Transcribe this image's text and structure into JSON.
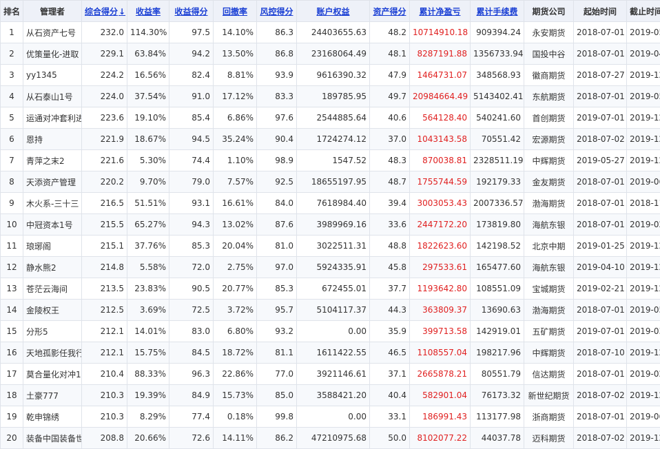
{
  "table": {
    "headers": {
      "rank": "排名",
      "manager": "管理者",
      "composite_score": "综合得分",
      "sort_arrow": "↓",
      "return_rate": "收益率",
      "return_score": "收益得分",
      "drawdown": "回撤率",
      "risk_score": "风控得分",
      "equity": "账户权益",
      "asset_score": "资产得分",
      "net_pnl": "累计净盈亏",
      "fees": "累计手续费",
      "broker": "期货公司",
      "start_date": "起始时间",
      "end_date": "截止时间"
    },
    "pnl_color": "#e02020",
    "link_color": "#1a3fd4",
    "rows": [
      {
        "rank": "1",
        "manager": "从石资产七号",
        "composite_score": "232.0",
        "return_rate": "114.30%",
        "return_score": "97.5",
        "drawdown": "14.10%",
        "risk_score": "86.3",
        "equity": "24403655.63",
        "asset_score": "48.2",
        "net_pnl": "10714910.18",
        "fees": "909394.24",
        "broker": "永安期货",
        "start_date": "2018-07-01",
        "end_date": "2019-05-08"
      },
      {
        "rank": "2",
        "manager": "优策量化-进取",
        "composite_score": "229.1",
        "return_rate": "63.84%",
        "return_score": "94.2",
        "drawdown": "13.50%",
        "risk_score": "86.8",
        "equity": "23168064.49",
        "asset_score": "48.1",
        "net_pnl": "8287191.88",
        "fees": "1356733.94",
        "broker": "国投中谷",
        "start_date": "2018-07-01",
        "end_date": "2019-04-15"
      },
      {
        "rank": "3",
        "manager": "yy1345",
        "composite_score": "224.2",
        "return_rate": "16.56%",
        "return_score": "82.4",
        "drawdown": "8.81%",
        "risk_score": "93.9",
        "equity": "9616390.32",
        "asset_score": "47.9",
        "net_pnl": "1464731.07",
        "fees": "348568.93",
        "broker": "徽商期货",
        "start_date": "2018-07-27",
        "end_date": "2019-12-30"
      },
      {
        "rank": "4",
        "manager": "从石泰山1号",
        "composite_score": "224.0",
        "return_rate": "37.54%",
        "return_score": "91.0",
        "drawdown": "17.12%",
        "risk_score": "83.3",
        "equity": "189785.95",
        "asset_score": "49.7",
        "net_pnl": "20984664.49",
        "fees": "5143402.41",
        "broker": "东航期货",
        "start_date": "2018-07-01",
        "end_date": "2019-05-08"
      },
      {
        "rank": "5",
        "manager": "运通对冲套利进",
        "composite_score": "223.6",
        "return_rate": "19.10%",
        "return_score": "85.4",
        "drawdown": "6.86%",
        "risk_score": "97.6",
        "equity": "2544885.64",
        "asset_score": "40.6",
        "net_pnl": "564128.40",
        "fees": "540241.60",
        "broker": "首创期货",
        "start_date": "2019-07-01",
        "end_date": "2019-12-30"
      },
      {
        "rank": "6",
        "manager": "恩持",
        "composite_score": "221.9",
        "return_rate": "18.67%",
        "return_score": "94.5",
        "drawdown": "35.24%",
        "risk_score": "90.4",
        "equity": "1724274.12",
        "asset_score": "37.0",
        "net_pnl": "1043143.58",
        "fees": "70551.42",
        "broker": "宏源期货",
        "start_date": "2018-07-02",
        "end_date": "2019-12-30"
      },
      {
        "rank": "7",
        "manager": "青萍之末2",
        "composite_score": "221.6",
        "return_rate": "5.30%",
        "return_score": "74.4",
        "drawdown": "1.10%",
        "risk_score": "98.9",
        "equity": "1547.52",
        "asset_score": "48.3",
        "net_pnl": "870038.81",
        "fees": "2328511.19",
        "broker": "中辉期货",
        "start_date": "2019-05-27",
        "end_date": "2019-12-30"
      },
      {
        "rank": "8",
        "manager": "天添资产管理",
        "composite_score": "220.2",
        "return_rate": "9.70%",
        "return_score": "79.0",
        "drawdown": "7.57%",
        "risk_score": "92.5",
        "equity": "18655197.95",
        "asset_score": "48.7",
        "net_pnl": "1755744.59",
        "fees": "192179.33",
        "broker": "金友期货",
        "start_date": "2018-07-01",
        "end_date": "2019-06-27"
      },
      {
        "rank": "9",
        "manager": "木火系-三十三",
        "composite_score": "216.5",
        "return_rate": "51.51%",
        "return_score": "93.1",
        "drawdown": "16.61%",
        "risk_score": "84.0",
        "equity": "7618984.40",
        "asset_score": "39.4",
        "net_pnl": "3003053.43",
        "fees": "2007336.57",
        "broker": "渤海期货",
        "start_date": "2018-07-01",
        "end_date": "2018-11-26"
      },
      {
        "rank": "10",
        "manager": "中冠资本1号",
        "composite_score": "215.5",
        "return_rate": "65.27%",
        "return_score": "94.3",
        "drawdown": "13.02%",
        "risk_score": "87.6",
        "equity": "3989969.16",
        "asset_score": "33.6",
        "net_pnl": "2447172.20",
        "fees": "173819.80",
        "broker": "海航东银",
        "start_date": "2018-07-01",
        "end_date": "2019-02-22"
      },
      {
        "rank": "11",
        "manager": "琅琊阁",
        "composite_score": "215.1",
        "return_rate": "37.76%",
        "return_score": "85.3",
        "drawdown": "20.04%",
        "risk_score": "81.0",
        "equity": "3022511.31",
        "asset_score": "48.8",
        "net_pnl": "1822623.60",
        "fees": "142198.52",
        "broker": "北京中期",
        "start_date": "2019-01-25",
        "end_date": "2019-12-30"
      },
      {
        "rank": "12",
        "manager": "静水熊2",
        "composite_score": "214.8",
        "return_rate": "5.58%",
        "return_score": "72.0",
        "drawdown": "2.75%",
        "risk_score": "97.0",
        "equity": "5924335.91",
        "asset_score": "45.8",
        "net_pnl": "297533.61",
        "fees": "165477.60",
        "broker": "海航东银",
        "start_date": "2019-04-10",
        "end_date": "2019-12-30"
      },
      {
        "rank": "13",
        "manager": "苍茫云海间",
        "composite_score": "213.5",
        "return_rate": "23.83%",
        "return_score": "90.5",
        "drawdown": "20.77%",
        "risk_score": "85.3",
        "equity": "672455.01",
        "asset_score": "37.7",
        "net_pnl": "1193642.80",
        "fees": "108551.09",
        "broker": "宝城期货",
        "start_date": "2019-02-21",
        "end_date": "2019-12-30"
      },
      {
        "rank": "14",
        "manager": "金陵权王",
        "composite_score": "212.5",
        "return_rate": "3.69%",
        "return_score": "72.5",
        "drawdown": "3.72%",
        "risk_score": "95.7",
        "equity": "5104117.37",
        "asset_score": "44.3",
        "net_pnl": "363809.37",
        "fees": "13690.63",
        "broker": "渤海期货",
        "start_date": "2018-07-01",
        "end_date": "2019-05-13"
      },
      {
        "rank": "15",
        "manager": "分形5",
        "composite_score": "212.1",
        "return_rate": "14.01%",
        "return_score": "83.0",
        "drawdown": "6.80%",
        "risk_score": "93.2",
        "equity": "0.00",
        "asset_score": "35.9",
        "net_pnl": "399713.58",
        "fees": "142919.01",
        "broker": "五矿期货",
        "start_date": "2019-07-01",
        "end_date": "2019-03-19"
      },
      {
        "rank": "16",
        "manager": "天地孤影任我行",
        "composite_score": "212.1",
        "return_rate": "15.75%",
        "return_score": "84.5",
        "drawdown": "18.72%",
        "risk_score": "81.1",
        "equity": "1611422.55",
        "asset_score": "46.5",
        "net_pnl": "1108557.04",
        "fees": "198217.96",
        "broker": "中辉期货",
        "start_date": "2018-07-10",
        "end_date": "2019-12-30"
      },
      {
        "rank": "17",
        "manager": "莫合量化对冲1号",
        "composite_score": "210.4",
        "return_rate": "88.33%",
        "return_score": "96.3",
        "drawdown": "22.86%",
        "risk_score": "77.0",
        "equity": "3921146.61",
        "asset_score": "37.1",
        "net_pnl": "2665878.21",
        "fees": "80551.79",
        "broker": "信达期货",
        "start_date": "2018-07-01",
        "end_date": "2019-02-28"
      },
      {
        "rank": "18",
        "manager": "土豪777",
        "composite_score": "210.3",
        "return_rate": "19.39%",
        "return_score": "84.9",
        "drawdown": "15.73%",
        "risk_score": "85.0",
        "equity": "3588421.20",
        "asset_score": "40.4",
        "net_pnl": "582901.04",
        "fees": "76173.32",
        "broker": "新世纪期货",
        "start_date": "2018-07-02",
        "end_date": "2019-12-30"
      },
      {
        "rank": "19",
        "manager": "乾申锦绣",
        "composite_score": "210.3",
        "return_rate": "8.29%",
        "return_score": "77.4",
        "drawdown": "0.18%",
        "risk_score": "99.8",
        "equity": "0.00",
        "asset_score": "33.1",
        "net_pnl": "186991.43",
        "fees": "113177.98",
        "broker": "浙商期货",
        "start_date": "2018-07-01",
        "end_date": "2019-06-10"
      },
      {
        "rank": "20",
        "manager": "装备中国装备世",
        "composite_score": "208.8",
        "return_rate": "20.66%",
        "return_score": "72.6",
        "drawdown": "14.11%",
        "risk_score": "86.2",
        "equity": "47210975.68",
        "asset_score": "50.0",
        "net_pnl": "8102077.22",
        "fees": "44037.78",
        "broker": "迈科期货",
        "start_date": "2018-07-02",
        "end_date": "2019-12-30"
      }
    ]
  }
}
